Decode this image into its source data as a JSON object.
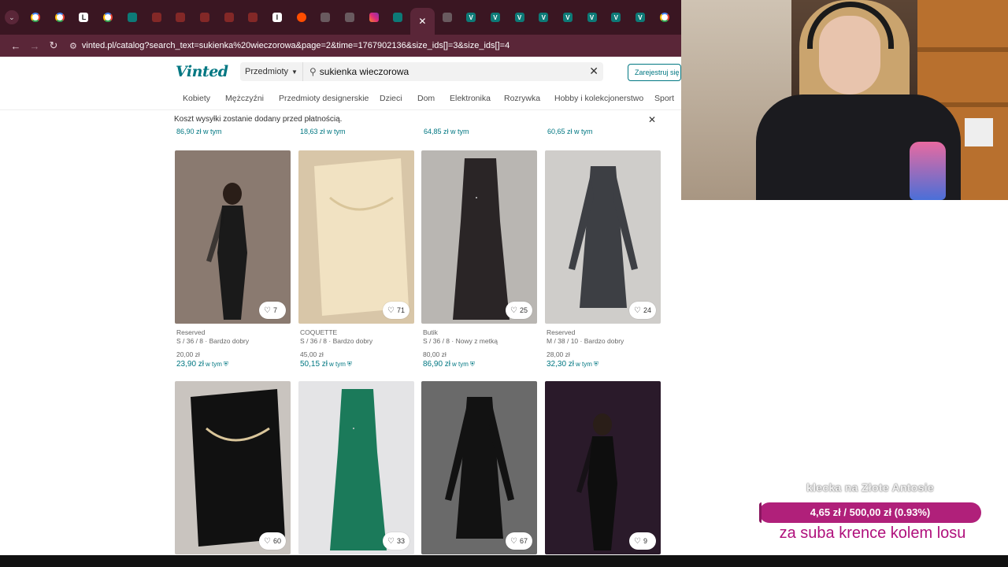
{
  "browser": {
    "tabs": [
      {
        "icon": "chevron-down-icon",
        "kind": "dropdown"
      },
      {
        "icon": "google-icon"
      },
      {
        "icon": "google-icon"
      },
      {
        "icon": "l-app-icon",
        "glyph": "L"
      },
      {
        "icon": "google-icon"
      },
      {
        "icon": "teal-app-icon"
      },
      {
        "icon": "red-app-icon"
      },
      {
        "icon": "red-app-icon"
      },
      {
        "icon": "red-app-icon"
      },
      {
        "icon": "red-app-icon"
      },
      {
        "icon": "red-app-icon"
      },
      {
        "icon": "l-app-icon",
        "glyph": "I"
      },
      {
        "icon": "play-app-icon"
      },
      {
        "icon": "doc-icon"
      },
      {
        "icon": "doc-icon"
      },
      {
        "icon": "instagram-icon"
      },
      {
        "icon": "teal-app-icon"
      },
      {
        "icon": "close-icon",
        "active": true
      },
      {
        "icon": "doc-icon"
      },
      {
        "icon": "vinted-icon"
      },
      {
        "icon": "vinted-icon"
      },
      {
        "icon": "vinted-icon"
      },
      {
        "icon": "vinted-icon"
      },
      {
        "icon": "vinted-icon"
      },
      {
        "icon": "vinted-icon"
      },
      {
        "icon": "vinted-icon"
      },
      {
        "icon": "vinted-icon"
      },
      {
        "icon": "google-icon"
      }
    ],
    "url": "vinted.pl/catalog?search_text=sukienka%20wieczorowa&page=2&time=1767902136&size_ids[]=3&size_ids[]=4"
  },
  "header": {
    "logo": "Vinted",
    "category_select": "Przedmioty",
    "search_value": "sukienka wieczorowa",
    "signup": "Zarejestruj się | Zaloguj się"
  },
  "catnav": [
    "Kobiety",
    "Mężczyźni",
    "Przedmioty designerskie",
    "Dzieci",
    "Dom",
    "Elektronika",
    "Rozrywka",
    "Hobby i kolekcjonerstwo",
    "Sport"
  ],
  "banner": "Koszt wysyłki zostanie dodany przed płatnością.",
  "prev_row_prices": [
    "86,90 zł w tym",
    "18,63 zł w tym",
    "64,85 zł w tym",
    "60,65 zł w tym"
  ],
  "row1": [
    {
      "brand": "Reserved",
      "details": "S / 36 / 8 · Bardzo dobry",
      "price": "20,00 zł",
      "total": "23,90 zł",
      "incl": "w tym",
      "favs": "7",
      "colors": {
        "bg": "#8a7a70",
        "dress": "#1a1a1a"
      }
    },
    {
      "brand": "COQUETTE",
      "details": "S / 36 / 8 · Bardzo dobry",
      "price": "45,00 zł",
      "total": "50,15 zł",
      "incl": "w tym",
      "favs": "71",
      "colors": {
        "bg": "#d8c6a8",
        "dress": "#f1e2c2"
      }
    },
    {
      "brand": "Butik",
      "details": "S / 36 / 8 · Nowy z metką",
      "price": "80,00 zł",
      "total": "86,90 zł",
      "incl": "w tym",
      "favs": "25",
      "colors": {
        "bg": "#b9b6b2",
        "dress": "#2a2526"
      }
    },
    {
      "brand": "Reserved",
      "details": "M / 38 / 10 · Bardzo dobry",
      "price": "28,00 zł",
      "total": "32,30 zł",
      "incl": "w tym",
      "favs": "24",
      "colors": {
        "bg": "#cfcdca",
        "dress": "#3d3f44"
      }
    }
  ],
  "row2": [
    {
      "favs": "60",
      "colors": {
        "bg": "#c9c4bf",
        "dress": "#111111"
      }
    },
    {
      "favs": "33",
      "colors": {
        "bg": "#e4e4e6",
        "dress": "#1b7a5a"
      }
    },
    {
      "favs": "67",
      "colors": {
        "bg": "#6a6a6a",
        "dress": "#121212"
      }
    },
    {
      "favs": "9",
      "colors": {
        "bg": "#2a1a2a",
        "dress": "#0e0e0e"
      }
    }
  ],
  "overlay": {
    "title": "klecka na Złote Antosie",
    "progress_text": "4,65 zł / 500,00 zł (0.93%)",
    "progress_fraction": 0.0093,
    "subtitle": "za suba krence kolem losu"
  },
  "colors": {
    "brand": "#007782",
    "tabstrip": "#3a1622",
    "overlay_bar": "#b0207a"
  }
}
